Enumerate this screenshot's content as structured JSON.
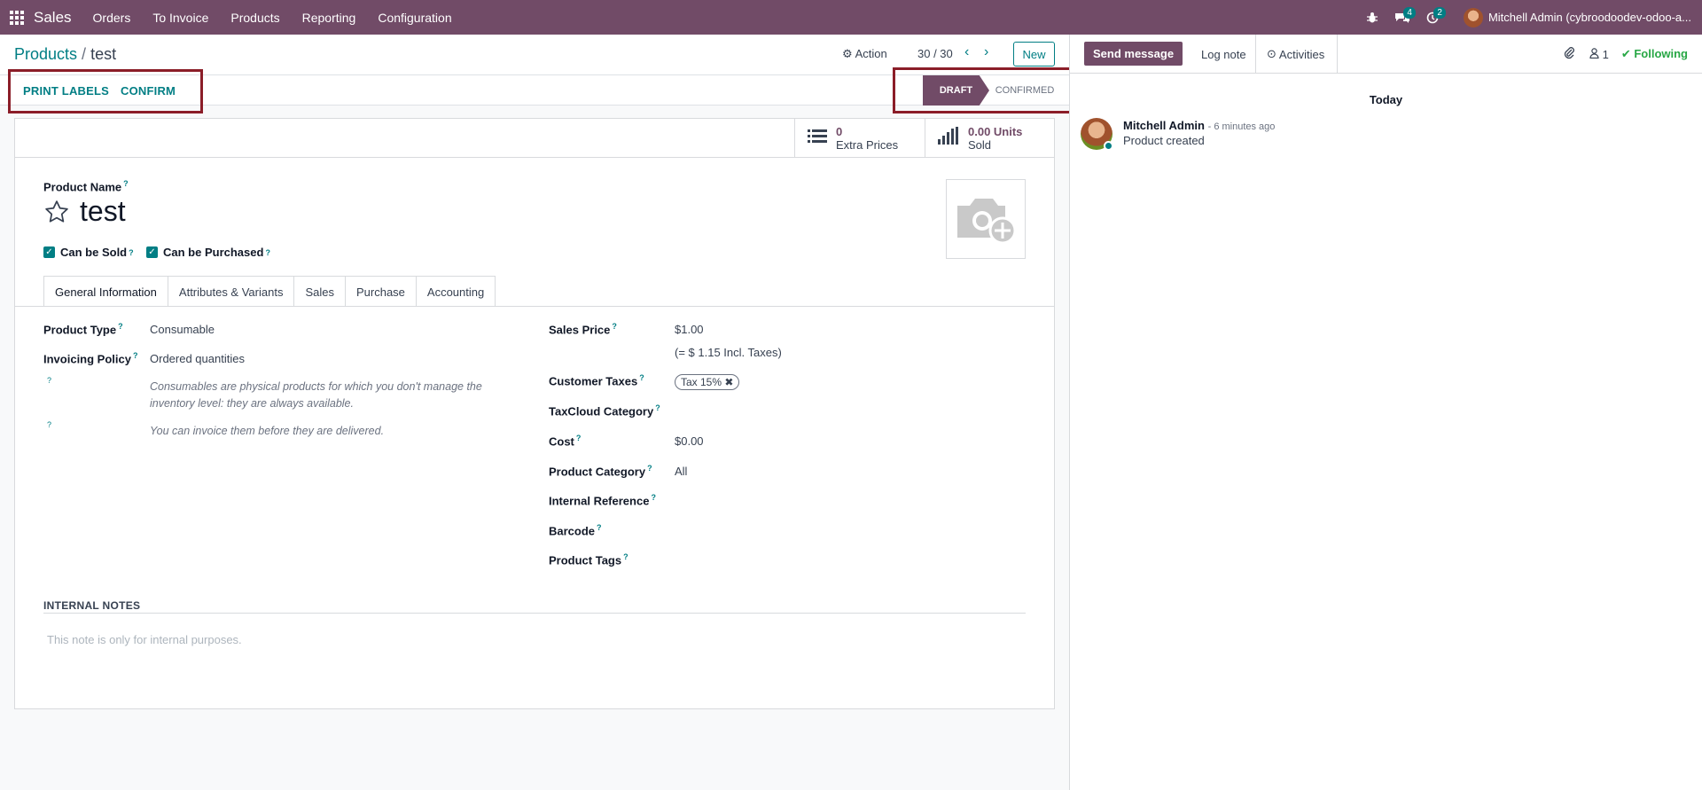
{
  "navbar": {
    "app_name": "Sales",
    "menu": [
      "Orders",
      "To Invoice",
      "Products",
      "Reporting",
      "Configuration"
    ],
    "messages_badge": "4",
    "activities_badge": "2",
    "user": "Mitchell Admin (cybroodoodev-odoo-a..."
  },
  "control": {
    "breadcrumb_parent": "Products",
    "breadcrumb_sep": "/",
    "breadcrumb_current": "test",
    "action_label": "Action",
    "pager": "30 / 30",
    "new_label": "New"
  },
  "header": {
    "print_labels": "PRINT LABELS",
    "confirm": "CONFIRM",
    "stages": [
      "DRAFT",
      "CONFIRMED"
    ],
    "active_stage": "DRAFT"
  },
  "stats": {
    "extra_prices_value": "0",
    "extra_prices_label": "Extra Prices",
    "sold_value": "0.00 Units",
    "sold_label": "Sold"
  },
  "product": {
    "name_label": "Product Name",
    "name": "test",
    "can_be_sold": "Can be Sold",
    "can_be_purchased": "Can be Purchased"
  },
  "tabs": [
    "General Information",
    "Attributes & Variants",
    "Sales",
    "Purchase",
    "Accounting"
  ],
  "general": {
    "product_type_label": "Product Type",
    "product_type": "Consumable",
    "invoicing_policy_label": "Invoicing Policy",
    "invoicing_policy": "Ordered quantities",
    "help_consumable": "Consumables are physical products for which you don't manage the inventory level: they are always available.",
    "help_invoice": "You can invoice them before they are delivered.",
    "sales_price_label": "Sales Price",
    "sales_price": "$1.00",
    "incl_taxes": "(= $ 1.15 Incl. Taxes)",
    "customer_taxes_label": "Customer Taxes",
    "customer_tax_tag": "Tax 15%",
    "taxcloud_label": "TaxCloud Category",
    "cost_label": "Cost",
    "cost": "$0.00",
    "category_label": "Product Category",
    "category": "All",
    "internal_ref_label": "Internal Reference",
    "barcode_label": "Barcode",
    "tags_label": "Product Tags"
  },
  "notes": {
    "label": "INTERNAL NOTES",
    "placeholder": "This note is only for internal purposes."
  },
  "chatter": {
    "send_message": "Send message",
    "log_note": "Log note",
    "activities": "Activities",
    "followers_count": "1",
    "following": "Following",
    "today": "Today",
    "author": "Mitchell Admin",
    "time": "- 6 minutes ago",
    "body": "Product created"
  },
  "colors": {
    "brand": "#714b67",
    "accent": "#017e84",
    "highlight": "#8b1d28",
    "following": "#28a745"
  }
}
